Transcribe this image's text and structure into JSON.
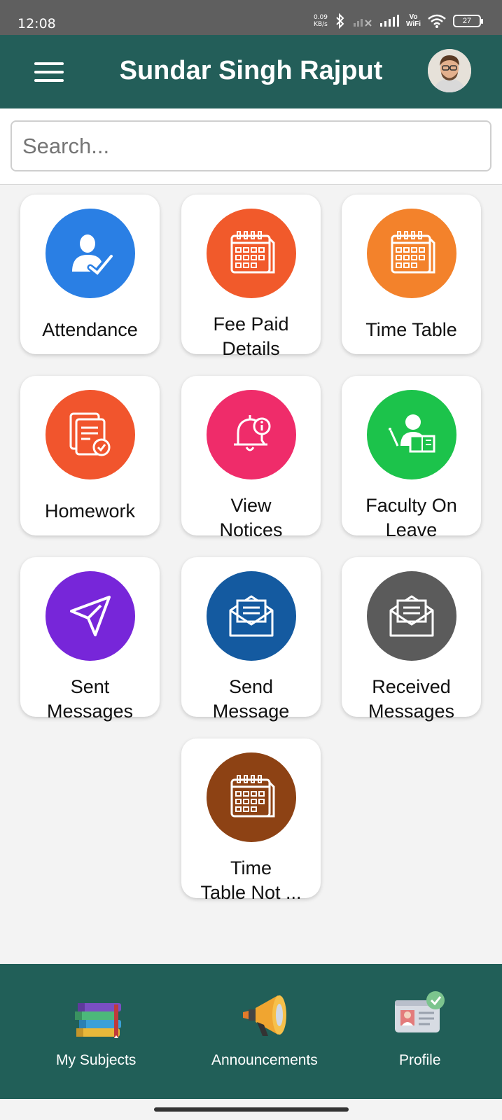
{
  "status_bar": {
    "time": "12:08",
    "speed_value": "0.09",
    "speed_unit": "KB/s",
    "vo": "Vo",
    "wifi_text": "WiFi",
    "battery": "27"
  },
  "header": {
    "title": "Sundar Singh Rajput",
    "menu_icon": "hamburger-menu-icon",
    "avatar_icon": "user-avatar"
  },
  "search": {
    "placeholder": "Search..."
  },
  "tiles": [
    {
      "line1": "Attendance",
      "line2": "",
      "color": "#2a7fe4",
      "icon": "attendance-icon"
    },
    {
      "line1": "Fee Paid",
      "line2": "Details",
      "color": "#f15a2b",
      "icon": "calendar-icon"
    },
    {
      "line1": "Time Table",
      "line2": "",
      "color": "#f3822b",
      "icon": "calendar-icon"
    },
    {
      "line1": "Homework",
      "line2": "",
      "color": "#f1552d",
      "icon": "homework-icon"
    },
    {
      "line1": "View",
      "line2": "Notices",
      "color": "#ef2c6a",
      "icon": "notice-bell-icon"
    },
    {
      "line1": "Faculty On",
      "line2": "Leave",
      "color": "#1cc34b",
      "icon": "faculty-icon"
    },
    {
      "line1": "Sent",
      "line2": "Messages",
      "color": "#7726d9",
      "icon": "send-icon"
    },
    {
      "line1": "Send",
      "line2": "Message",
      "color": "#145aa0",
      "icon": "envelope-icon"
    },
    {
      "line1": "Received",
      "line2": "Messages",
      "color": "#5b5b5b",
      "icon": "envelope-icon"
    },
    {
      "line1": "Time",
      "line2": "Table Not ...",
      "color": "#8d4214",
      "icon": "calendar-icon"
    }
  ],
  "bottom_nav": [
    {
      "label": "My Subjects",
      "icon": "books-icon"
    },
    {
      "label": "Announcements",
      "icon": "megaphone-icon"
    },
    {
      "label": "Profile",
      "icon": "id-card-icon"
    }
  ]
}
